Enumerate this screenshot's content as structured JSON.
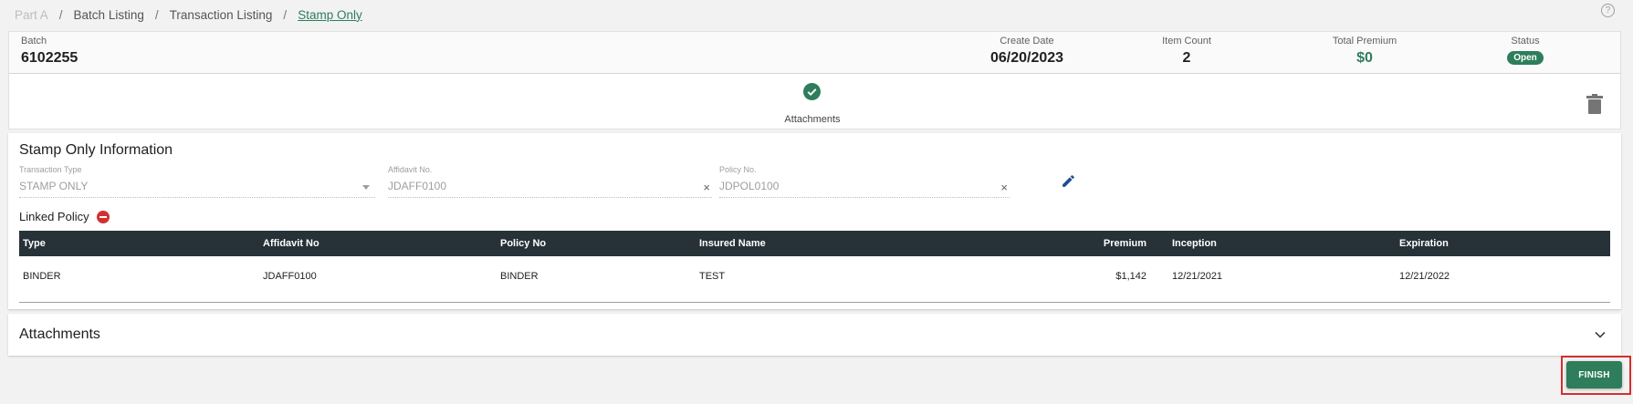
{
  "breadcrumb": {
    "items": [
      "Part A",
      "Batch Listing",
      "Transaction Listing",
      "Stamp Only"
    ],
    "separator": "/"
  },
  "help": {
    "glyph": "?"
  },
  "batch": {
    "batch_label": "Batch",
    "batch_value": "6102255",
    "create_date_label": "Create Date",
    "create_date_value": "06/20/2023",
    "item_count_label": "Item Count",
    "item_count_value": "2",
    "total_premium_label": "Total Premium",
    "total_premium_value": "$0",
    "status_label": "Status",
    "status_value": "Open"
  },
  "attachments_indicator": {
    "label": "Attachments",
    "icon": "check-circle-icon"
  },
  "stamp_info": {
    "title": "Stamp Only Information",
    "transaction_type": {
      "label": "Transaction Type",
      "value": "STAMP ONLY"
    },
    "affidavit_no": {
      "label": "Affidavit No.",
      "value": "JDAFF0100"
    },
    "policy_no": {
      "label": "Policy No.",
      "value": "JDPOL0100"
    },
    "clear_glyph": "×",
    "linked_policy_label": "Linked Policy"
  },
  "linked_table": {
    "columns": [
      "Type",
      "Affidavit No",
      "Policy No",
      "Insured Name",
      "Premium",
      "Inception",
      "Expiration"
    ],
    "rows": [
      [
        "BINDER",
        "JDAFF0100",
        "BINDER",
        "TEST",
        "$1,142",
        "12/21/2021",
        "12/21/2022"
      ]
    ]
  },
  "attachments_section": {
    "title": "Attachments"
  },
  "finish_label": "FINISH",
  "colors": {
    "accent": "#2e7d5b",
    "header_dark": "#263238",
    "danger": "#d32f2f"
  }
}
